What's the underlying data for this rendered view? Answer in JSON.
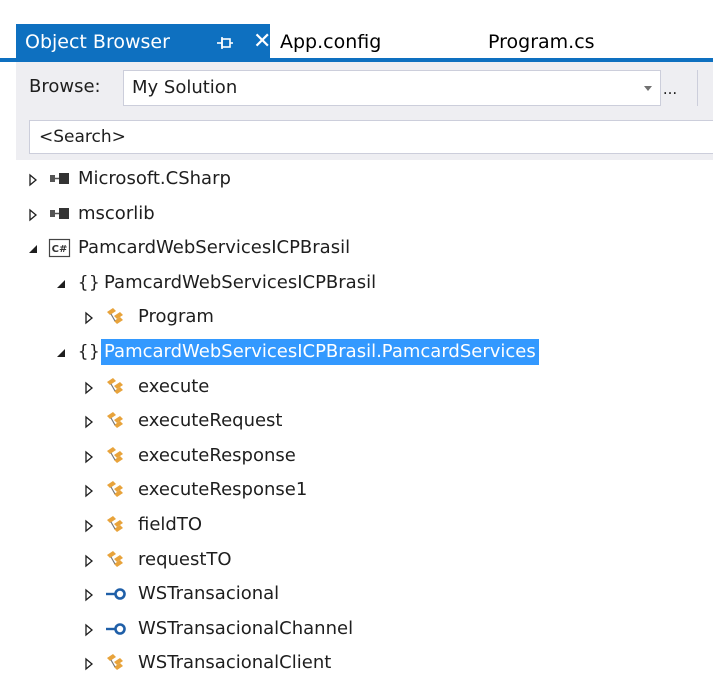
{
  "tabs": {
    "active": "Object Browser",
    "others": [
      "App.config",
      "Program.cs"
    ]
  },
  "toolbar": {
    "browse_label": "Browse:",
    "browse_value": "My Solution",
    "more_label": "..."
  },
  "search": {
    "placeholder": "<Search>"
  },
  "tree": {
    "nodes": [
      {
        "label": "Microsoft.CSharp",
        "icon": "assembly-icon",
        "level": 0,
        "expanded": false
      },
      {
        "label": "mscorlib",
        "icon": "assembly-icon",
        "level": 0,
        "expanded": false
      },
      {
        "label": "PamcardWebServicesICPBrasil",
        "icon": "csharp-project-icon",
        "level": 0,
        "expanded": true
      },
      {
        "label": "PamcardWebServicesICPBrasil",
        "icon": "namespace-icon",
        "level": 1,
        "expanded": true
      },
      {
        "label": "Program",
        "icon": "class-icon",
        "level": 2,
        "expanded": false
      },
      {
        "label": "PamcardWebServicesICPBrasil.PamcardServices",
        "icon": "namespace-icon",
        "level": 1,
        "expanded": true,
        "selected": true
      },
      {
        "label": "execute",
        "icon": "class-icon",
        "level": 2,
        "expanded": false
      },
      {
        "label": "executeRequest",
        "icon": "class-icon",
        "level": 2,
        "expanded": false
      },
      {
        "label": "executeResponse",
        "icon": "class-icon",
        "level": 2,
        "expanded": false
      },
      {
        "label": "executeResponse1",
        "icon": "class-icon",
        "level": 2,
        "expanded": false
      },
      {
        "label": "fieldTO",
        "icon": "class-icon",
        "level": 2,
        "expanded": false
      },
      {
        "label": "requestTO",
        "icon": "class-icon",
        "level": 2,
        "expanded": false
      },
      {
        "label": "WSTransacional",
        "icon": "interface-icon",
        "level": 2,
        "expanded": false
      },
      {
        "label": "WSTransacionalChannel",
        "icon": "interface-icon",
        "level": 2,
        "expanded": false
      },
      {
        "label": "WSTransacionalClient",
        "icon": "class-icon",
        "level": 2,
        "expanded": false
      }
    ]
  },
  "colors": {
    "accent": "#0e70c0",
    "selection": "#3399ff",
    "class_icon": "#e8a33b",
    "interface_icon": "#1f5fa8"
  }
}
